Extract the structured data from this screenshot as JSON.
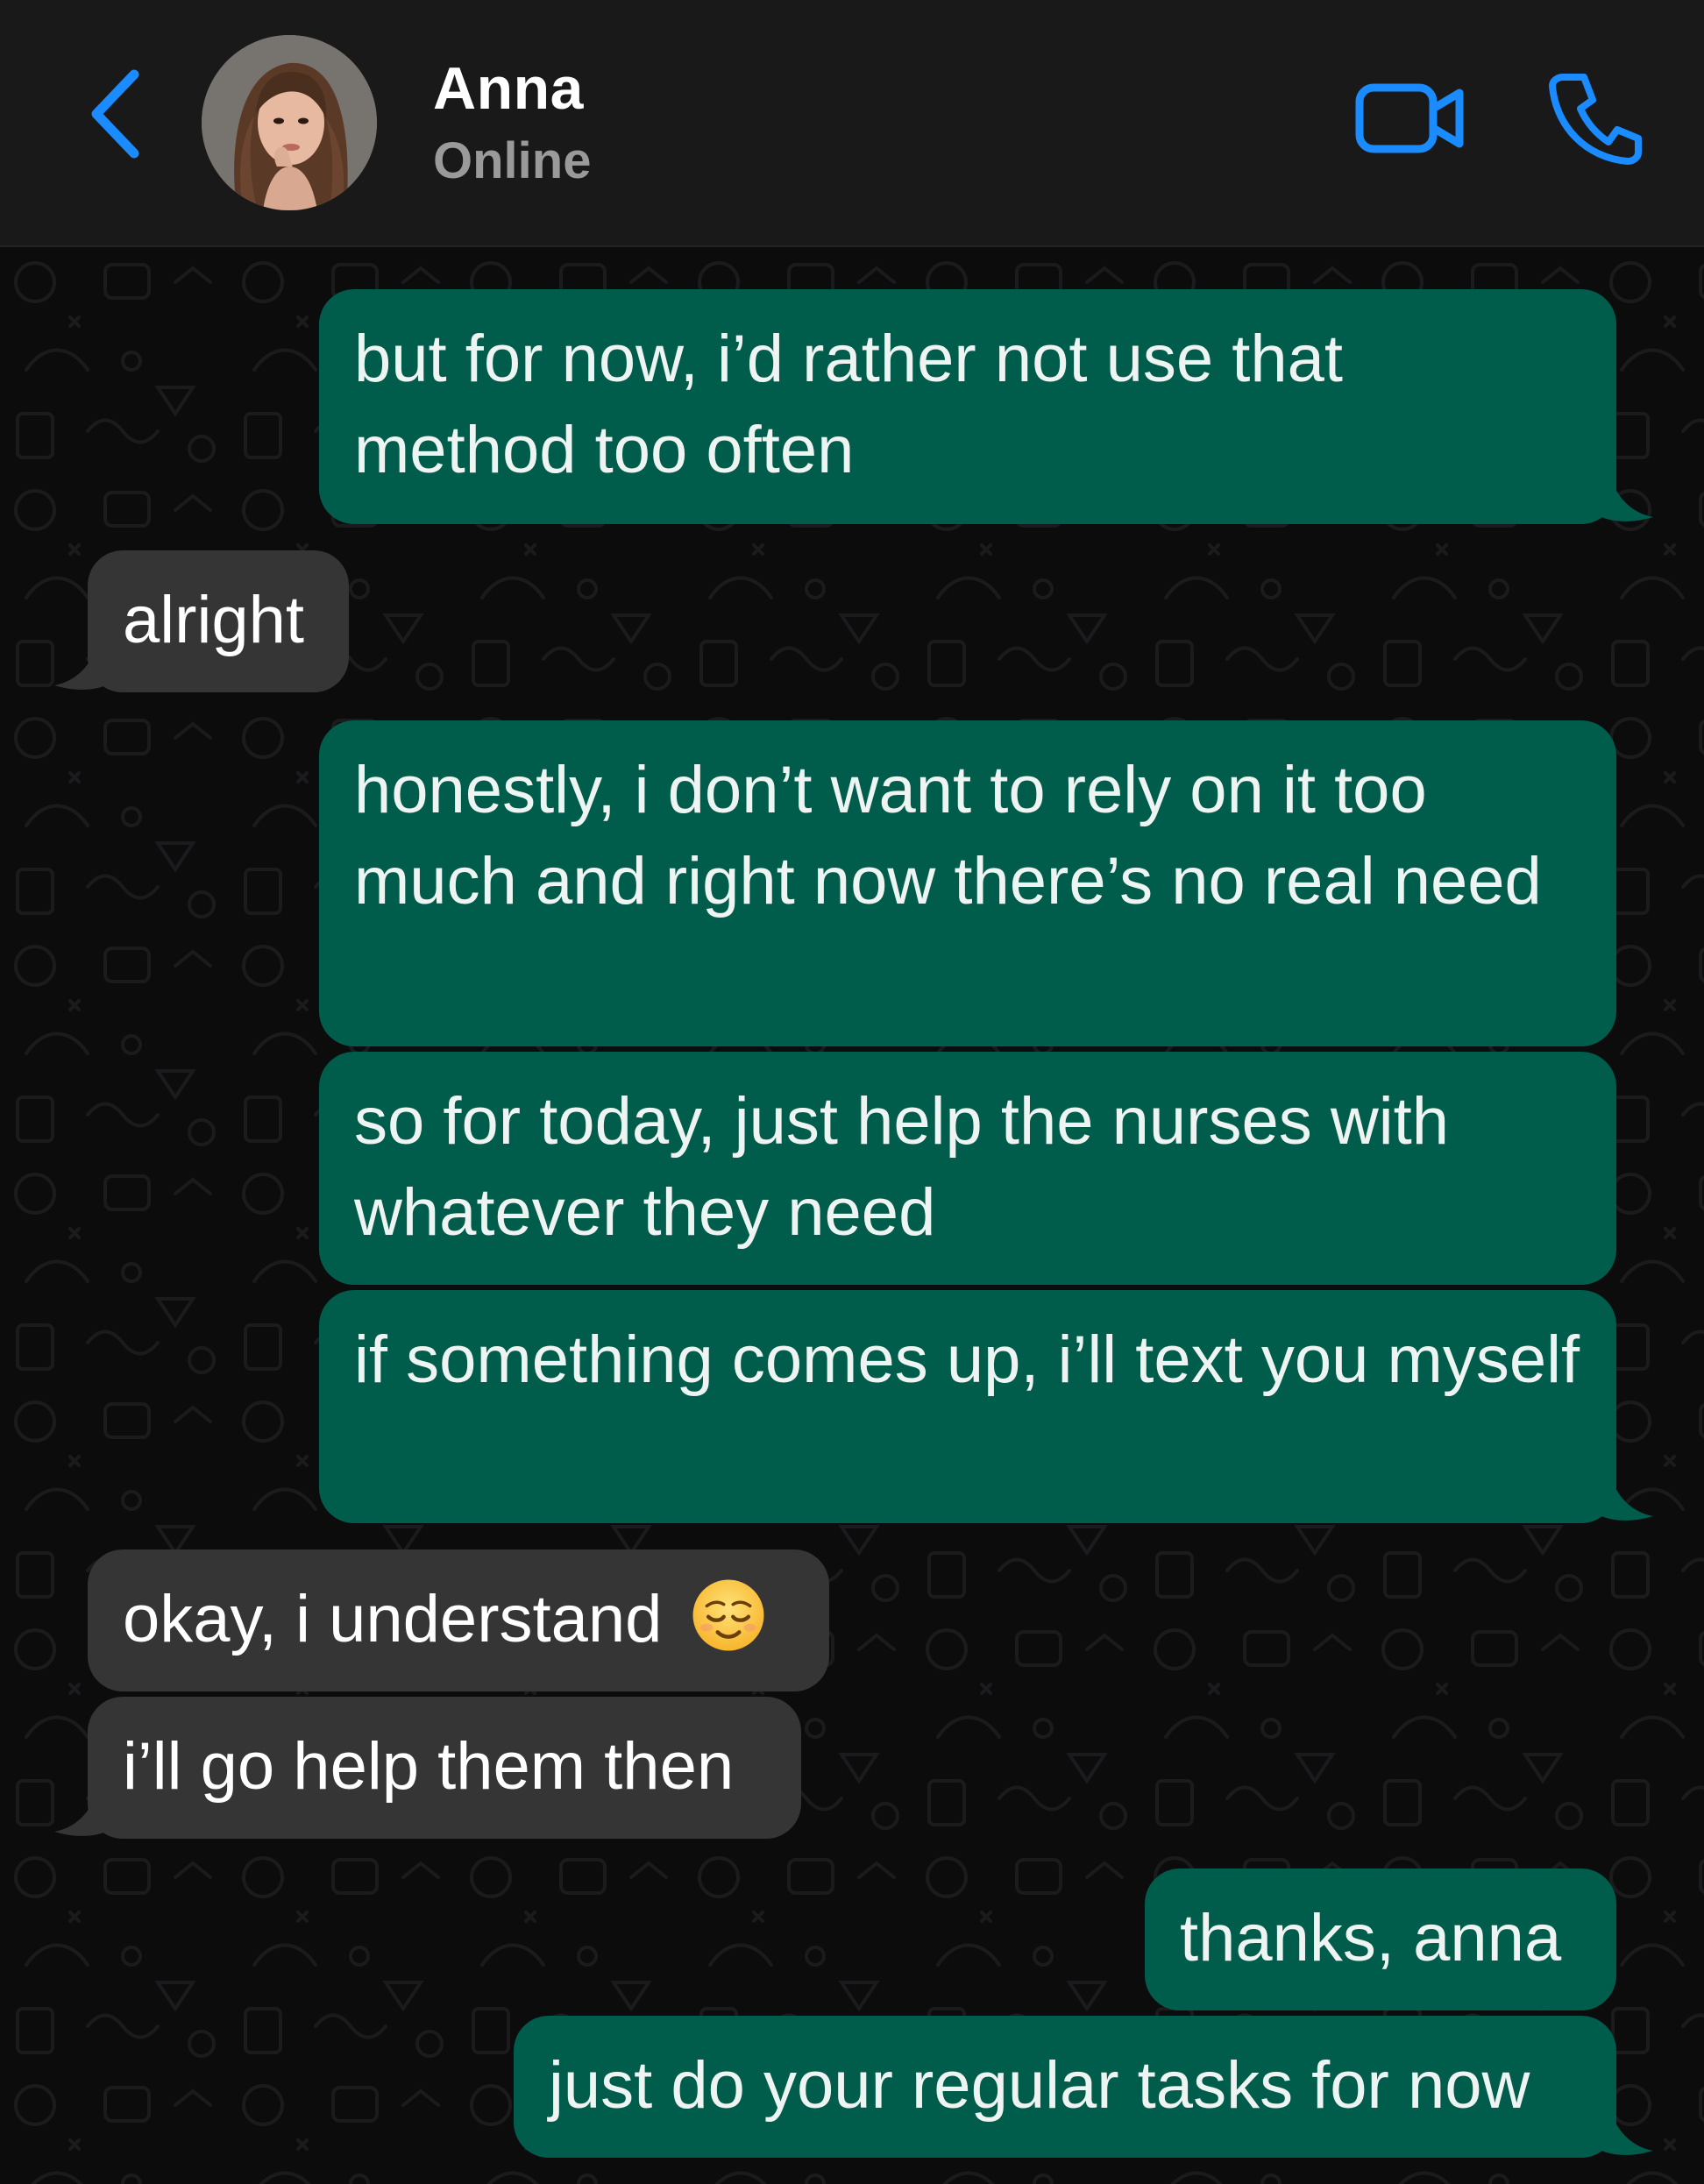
{
  "header": {
    "contact_name": "Anna",
    "contact_status": "Online"
  },
  "messages": [
    {
      "direction": "outgoing",
      "text": "but for now, i’d rather not use that method too often"
    },
    {
      "direction": "incoming",
      "text": "alright"
    },
    {
      "direction": "outgoing",
      "text": "honestly, i don’t want to rely on it too much and right now there’s no real need"
    },
    {
      "direction": "outgoing",
      "text": "so for today, just help the nurses with whatever they need"
    },
    {
      "direction": "outgoing",
      "text": "if something comes up, i’ll text you myself"
    },
    {
      "direction": "incoming",
      "text": "okay, i understand",
      "emoji": "relieved-face"
    },
    {
      "direction": "incoming",
      "text": "i’ll go help them then"
    },
    {
      "direction": "outgoing",
      "text": "thanks, anna"
    },
    {
      "direction": "outgoing",
      "text": "just do your regular tasks for now"
    }
  ],
  "colors": {
    "accent": "#1a8cff",
    "outgoing_bubble": "#005c4b",
    "incoming_bubble": "#353535",
    "header_bg": "#191919",
    "chat_bg": "#0c0c0d"
  },
  "icons": {
    "back": "chevron-left-icon",
    "video": "video-camera-icon",
    "call": "phone-icon",
    "emoji": "relieved-face-icon"
  }
}
